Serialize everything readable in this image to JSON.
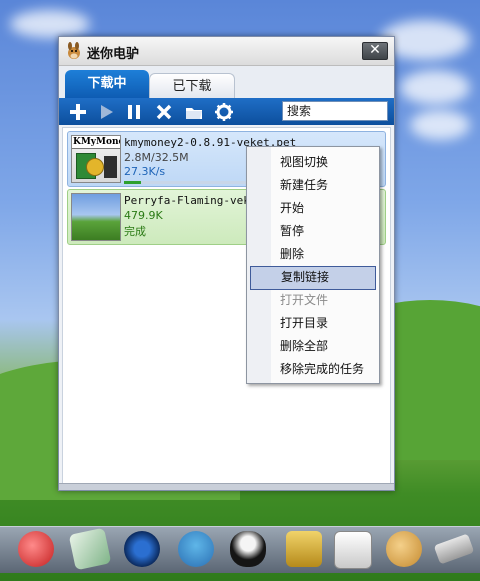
{
  "window": {
    "title": "迷你电驴",
    "close_symbol": "✕"
  },
  "tabs": [
    {
      "label": "下载中",
      "active": true
    },
    {
      "label": "已下载",
      "active": false
    }
  ],
  "toolbar": {
    "icons": [
      "add-icon",
      "play-icon",
      "pause-icon",
      "delete-icon",
      "folder-icon",
      "gear-icon"
    ],
    "search_placeholder": "搜索"
  },
  "downloads": [
    {
      "name": "kmymoney2-0.8.91-veket.pet",
      "thumb_label": "KMyMoney",
      "size": "2.8M/32.5M",
      "speed": "27.3K/s",
      "progress": 0.086
    },
    {
      "name": "Perryfa-Flaming-veket.",
      "size": "479.9K",
      "status": "完成"
    }
  ],
  "context_menu": {
    "items": [
      {
        "label": "视图切换"
      },
      {
        "label": "新建任务"
      },
      {
        "label": "开始"
      },
      {
        "label": "暂停"
      },
      {
        "label": "删除"
      },
      {
        "label": "复制链接",
        "selected": true
      },
      {
        "label": "打开文件",
        "disabled": true
      },
      {
        "label": "打开目录"
      },
      {
        "label": "删除全部"
      },
      {
        "label": "移除完成的任务"
      }
    ]
  },
  "colors": {
    "tab_active": "#1e7fd8",
    "toolbar": "#0d4f9d",
    "menu_selected": "#c4d0e8",
    "progress": "#2ea12e"
  }
}
